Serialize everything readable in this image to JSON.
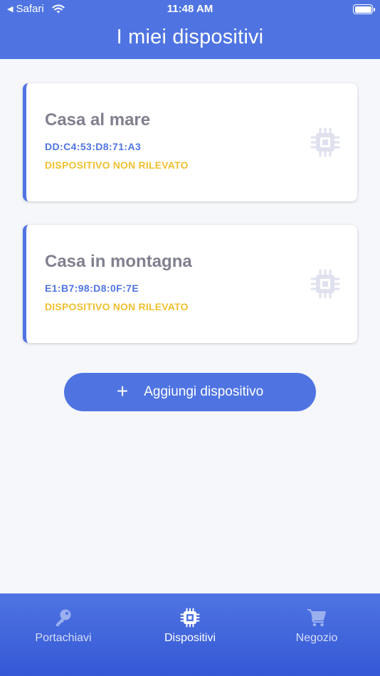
{
  "status_bar": {
    "back_app": "Safari",
    "time": "11:48 AM"
  },
  "header": {
    "title": "I miei dispositivi"
  },
  "devices": [
    {
      "name": "Casa al mare",
      "mac": "DD:C4:53:D8:71:A3",
      "status": "DISPOSITIVO NON RILEVATO",
      "icon": "chip-icon"
    },
    {
      "name": "Casa in montagna",
      "mac": "E1:B7:98:D8:0F:7E",
      "status": "DISPOSITIVO NON RILEVATO",
      "icon": "chip-icon"
    }
  ],
  "add_button": {
    "icon": "plus-icon",
    "label": "Aggiungi dispositivo"
  },
  "tabbar": {
    "tabs": [
      {
        "label": "Portachiavi",
        "icon": "key-icon",
        "active": false
      },
      {
        "label": "Dispositivi",
        "icon": "chip-icon",
        "active": true
      },
      {
        "label": "Negozio",
        "icon": "cart-icon",
        "active": false
      }
    ]
  },
  "colors": {
    "primary": "#4f74e2",
    "background": "#f6f7fb",
    "device_name": "#80808f",
    "warning": "#f0c030",
    "chip_icon": "#dfe2ee"
  }
}
